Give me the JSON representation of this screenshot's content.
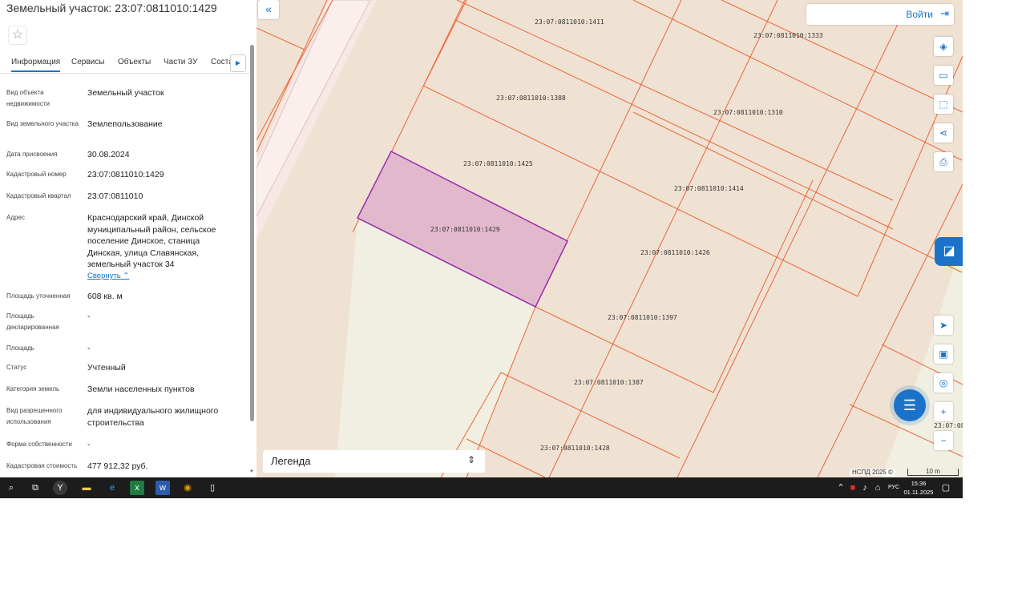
{
  "panel": {
    "title": "Земельный участок: 23:07:0811010:1429",
    "tabs": [
      "Информация",
      "Сервисы",
      "Объекты",
      "Части ЗУ",
      "Соста"
    ],
    "collapse_link": "Свернуть",
    "fields": [
      {
        "label": "Вид объекта недвижимости",
        "value": "Земельный участок"
      },
      {
        "label": "Вид земельного участка",
        "value": "Землепользование"
      },
      {
        "label": "Дата присвоения",
        "value": "30.08.2024"
      },
      {
        "label": "Кадастровый номер",
        "value": "23:07:0811010:1429"
      },
      {
        "label": "Кадастровый квартал",
        "value": "23:07:0811010"
      },
      {
        "label": "Адрес",
        "value": "Краснодарский край, Динской муниципальный район, сельское поселение Динское, станица Динская, улица Славянская, земельный участок 34"
      },
      {
        "label": "Площадь уточненная",
        "value": "608 кв. м"
      },
      {
        "label": "Площадь декларированная",
        "value": "-"
      },
      {
        "label": "Площадь",
        "value": "-"
      },
      {
        "label": "Статус",
        "value": "Учтенный"
      },
      {
        "label": "Категория земель",
        "value": "Земли населенных пунктов"
      },
      {
        "label": "Вид разрешенного использования",
        "value": "для индивидуального жилищного строительства"
      },
      {
        "label": "Форма собственности",
        "value": "-"
      },
      {
        "label": "Кадастровая стоимость",
        "value": "477 912,32 руб."
      }
    ]
  },
  "map": {
    "login_label": "Войти",
    "legend_label": "Легенда",
    "copyright": "НСПД 2025 ©",
    "scale_label": "10 m",
    "cut_label": "23:07:08",
    "parcels": [
      "23:07:0811010:1411",
      "23:07:0811010:1333",
      "23:07:0811010:1388",
      "23:07:0811010:1310",
      "23:07:0811010:1425",
      "23:07:0811010:1414",
      "23:07:0811010:1429",
      "23:07:0811010:1426",
      "23:07:0811010:1397",
      "23:07:0811010:1387",
      "23:07:0811010:1428"
    ],
    "selected_parcel": "23:07:0811010:1429",
    "colors": {
      "background": "#f0e2d3",
      "parcel_border": "#e8663a",
      "selected_fill": "#e2b9cc",
      "selected_border": "#9b2aa8",
      "accent": "#1a73c8"
    }
  },
  "taskbar": {
    "time": "15:36",
    "date": "01.11.2025",
    "language": "РУС"
  }
}
